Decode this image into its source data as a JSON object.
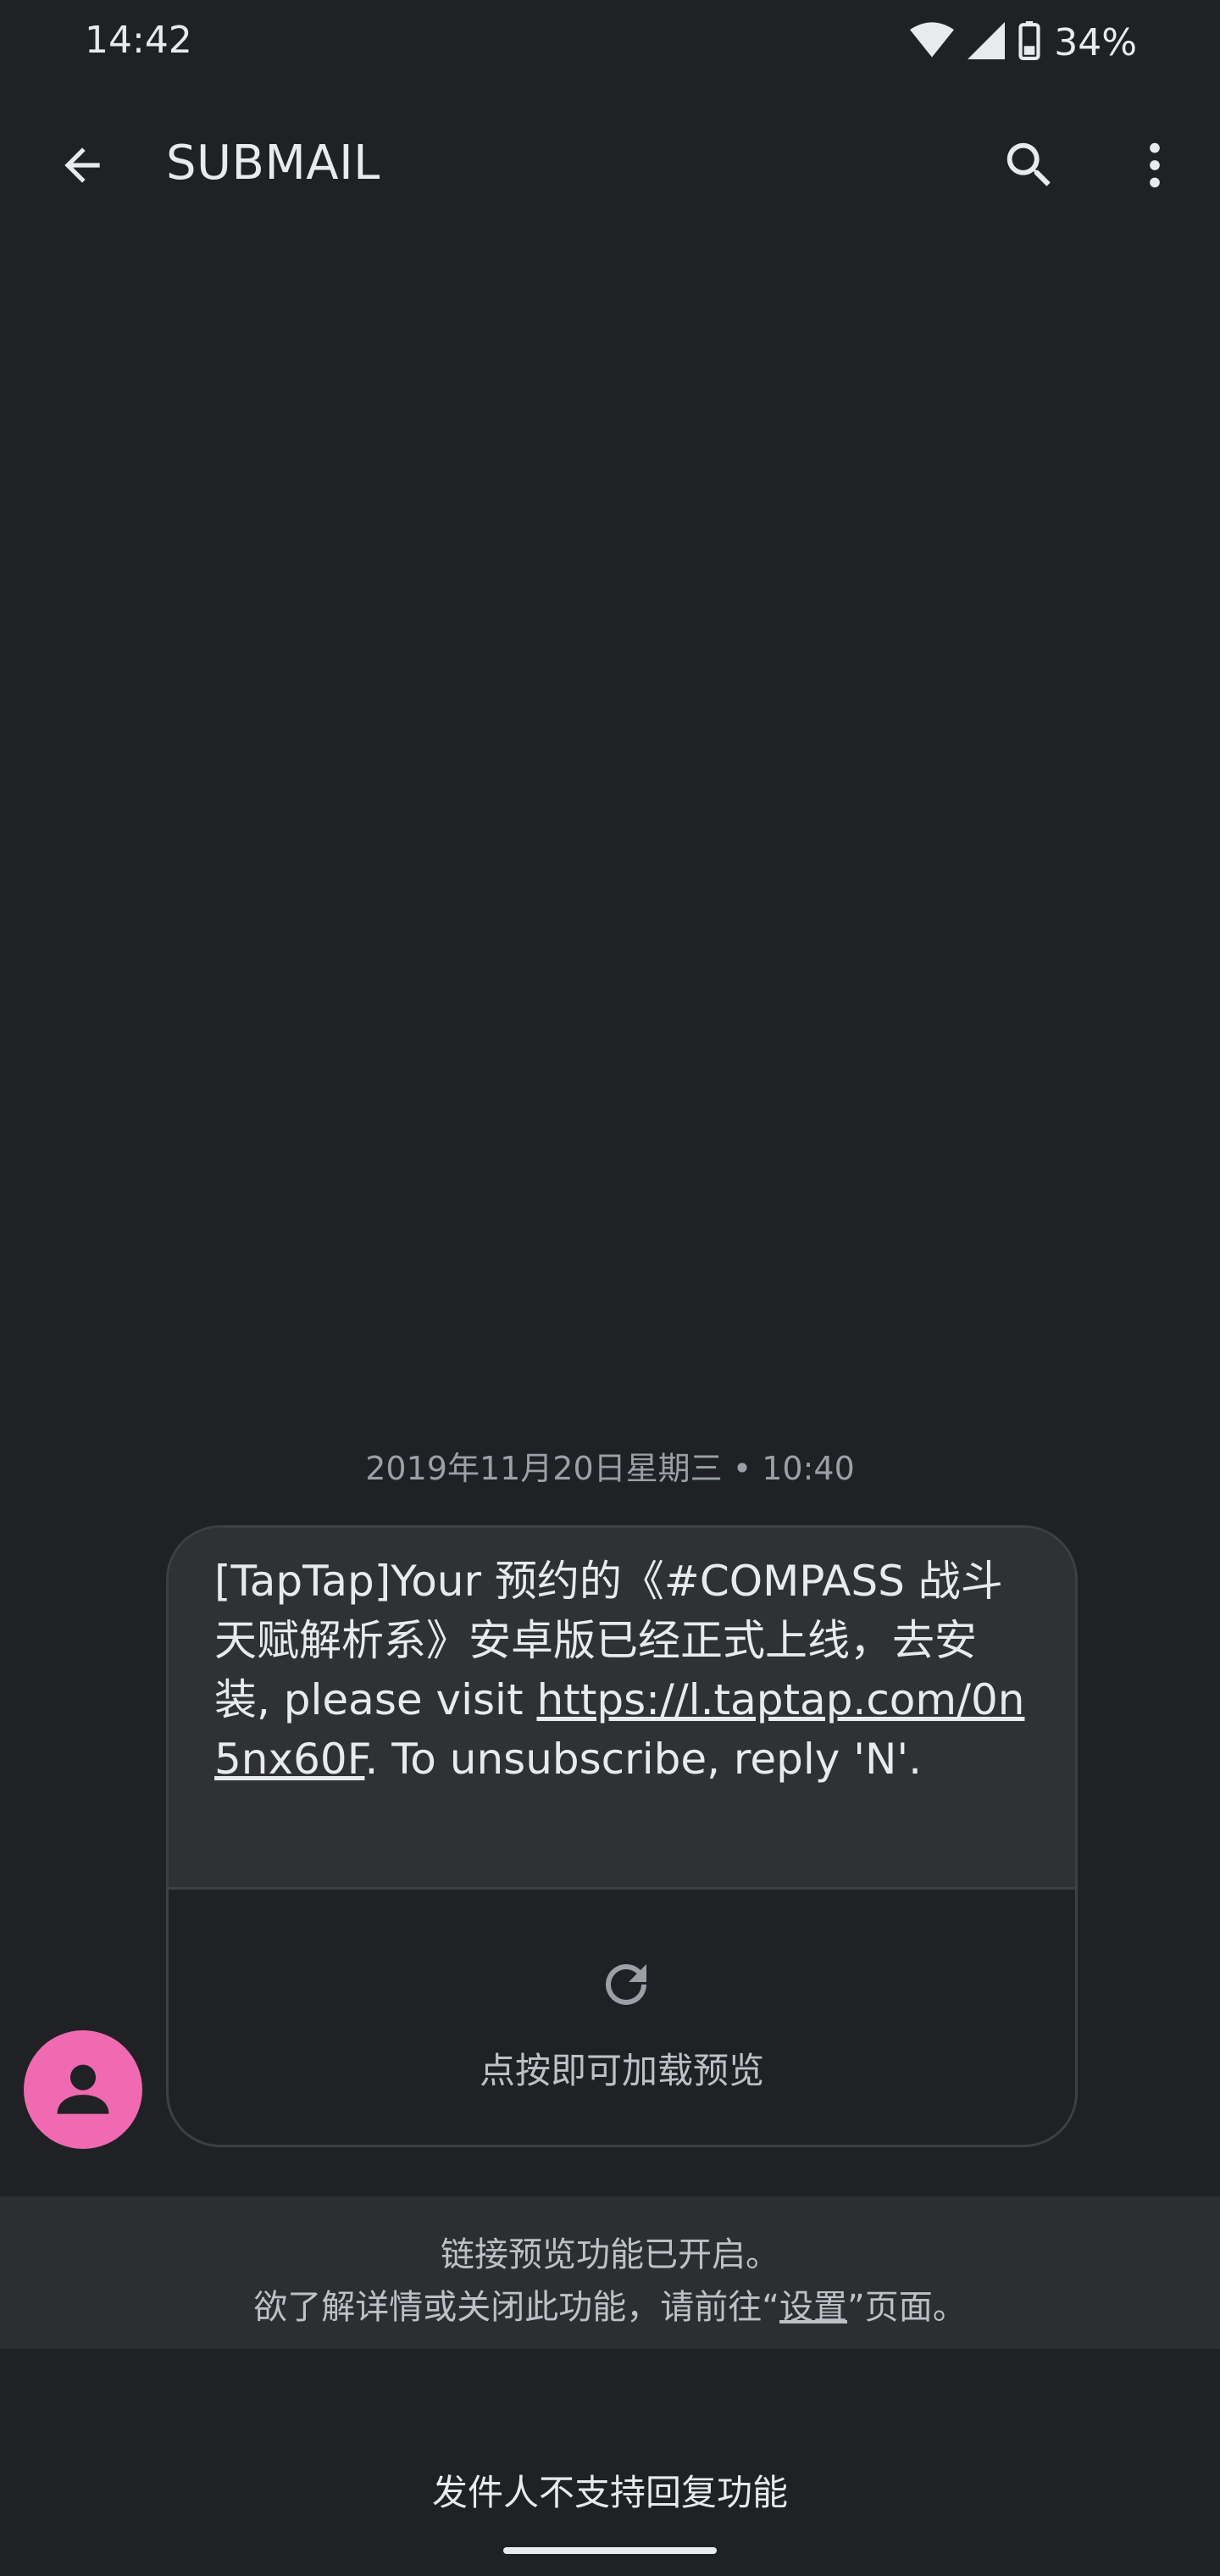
{
  "status_bar": {
    "time": "14:42",
    "battery_percent": "34%",
    "icons": [
      "wifi-icon",
      "cellular-signal-icon",
      "battery-icon"
    ]
  },
  "app_bar": {
    "title": "SUBMAIL",
    "icons": [
      "back-arrow-icon",
      "search-icon",
      "more-vert-icon"
    ]
  },
  "conversation": {
    "date_line": "2019年11月20日星期三 • 10:40",
    "message": {
      "text_before_link": "[TapTap]Your 预约的《#COMPASS 战斗天赋解析系》安卓版已经正式上线，去安装, please visit ",
      "link": "https://l.taptap.com/0n5nx60F",
      "text_after_link": ". To unsubscribe, reply 'N'.",
      "preview_label": "点按即可加载预览"
    },
    "avatar_color": "#f06ab1"
  },
  "notice": {
    "line1": "链接预览功能已开启。",
    "line2_before": "欲了解详情或关闭此功能，请前往“",
    "line2_link": "设置",
    "line2_after": "”页面。"
  },
  "footer": {
    "no_reply_text": "发件人不支持回复功能"
  },
  "colors": {
    "background": "#202124",
    "bubble": "#303134",
    "text": "#e8eaed",
    "secondary_text": "#9aa0a6",
    "avatar": "#f06ab1"
  }
}
